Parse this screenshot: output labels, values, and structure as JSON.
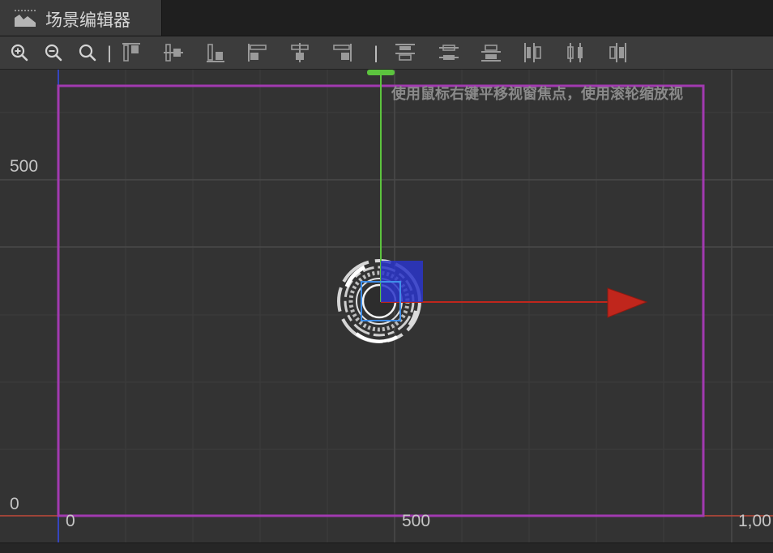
{
  "tab": {
    "title": "场景编辑器",
    "icon": "scene-editor-icon"
  },
  "toolbar": {
    "separator": "|",
    "buttons": [
      {
        "name": "zoom-in-button",
        "icon": "zoom-in-icon"
      },
      {
        "name": "zoom-out-button",
        "icon": "zoom-out-icon"
      },
      {
        "name": "zoom-reset-button",
        "icon": "zoom-reset-icon"
      },
      {
        "name": "align-top-button",
        "icon": "align-top-icon"
      },
      {
        "name": "align-vertical-center-button",
        "icon": "align-vertical-center-icon"
      },
      {
        "name": "align-bottom-button",
        "icon": "align-bottom-icon"
      },
      {
        "name": "align-left-button",
        "icon": "align-left-icon"
      },
      {
        "name": "align-horizontal-center-button",
        "icon": "align-horizontal-center-icon"
      },
      {
        "name": "align-right-button",
        "icon": "align-right-icon"
      },
      {
        "name": "distribute-top-button",
        "icon": "distribute-top-icon"
      },
      {
        "name": "distribute-vertical-center-button",
        "icon": "distribute-vertical-center-icon"
      },
      {
        "name": "distribute-bottom-button",
        "icon": "distribute-bottom-icon"
      },
      {
        "name": "distribute-left-button",
        "icon": "distribute-left-icon"
      },
      {
        "name": "distribute-horizontal-center-button",
        "icon": "distribute-horizontal-center-icon"
      },
      {
        "name": "distribute-right-button",
        "icon": "distribute-right-icon"
      }
    ]
  },
  "viewport": {
    "hint": "使用鼠标右键平移视窗焦点，使用滚轮缩放视",
    "y_ruler": {
      "label_500": "500",
      "label_0": "0"
    },
    "x_ruler": {
      "label_0": "0",
      "label_500": "500",
      "label_1000": "1,00"
    }
  },
  "colors": {
    "canvas_border": "#a23ab0",
    "x_axis_handle": "#c0261c",
    "y_axis_handle": "#5cc43e",
    "rect_handle": "#2a35c9",
    "selection_box": "#3f8ee8",
    "grid_minor": "#3d3d3d",
    "grid_major": "#4a4a4a",
    "origin_x": "#c24a3a",
    "origin_y": "#3545c0"
  }
}
